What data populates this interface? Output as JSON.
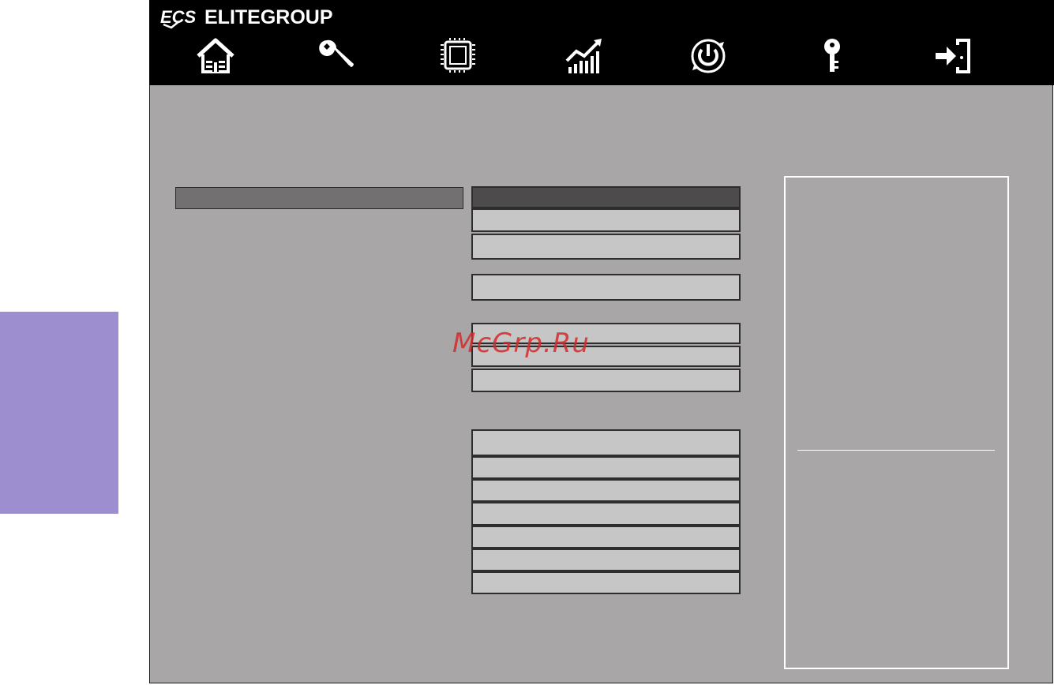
{
  "brand": {
    "logo_text": "ECS",
    "name": "ELITEGROUP"
  },
  "nav": [
    {
      "id": "main",
      "icon": "home-icon"
    },
    {
      "id": "advanced",
      "icon": "wrench-icon"
    },
    {
      "id": "chipset",
      "icon": "chip-icon"
    },
    {
      "id": "performance",
      "icon": "chart-icon"
    },
    {
      "id": "boot",
      "icon": "power-icon"
    },
    {
      "id": "security",
      "icon": "key-icon"
    },
    {
      "id": "exit",
      "icon": "exit-icon"
    }
  ],
  "watermark": "McGrp.Ru",
  "colors": {
    "topbar": "#000000",
    "main_bg": "#a8a6a7",
    "field_bg": "#c7c6c6",
    "field_selected_bg": "#4d4b4c",
    "left_bar_bg": "#727070",
    "side_tab": "#9d8fcf",
    "watermark": "#d42a2a"
  }
}
